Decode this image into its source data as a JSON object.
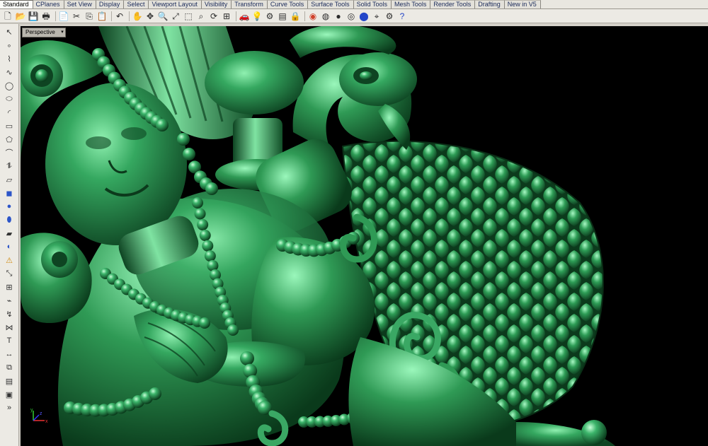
{
  "tabs": [
    "Standard",
    "CPlanes",
    "Set View",
    "Display",
    "Select",
    "Viewport Layout",
    "Visibility",
    "Transform",
    "Curve Tools",
    "Surface Tools",
    "Solid Tools",
    "Mesh Tools",
    "Render Tools",
    "Drafting",
    "New in V5"
  ],
  "active_tab": "Standard",
  "toolbar_icons": [
    "new-icon",
    "open-icon",
    "save-icon",
    "print-icon",
    "import-icon",
    "cut-icon",
    "copy-icon",
    "paste-icon",
    "undo-icon",
    "pan-icon",
    "move-view-icon",
    "zoom-icon",
    "zoom-extents-icon",
    "zoom-window-icon",
    "zoom-selected-icon",
    "rotate-view-icon",
    "four-viewports-icon",
    "car-icon",
    "bulb-icon",
    "tools-icon",
    "layer-icon",
    "lock-icon",
    "render-icon",
    "color-wheel-icon",
    "sphere-icon",
    "mesh-sphere-icon",
    "blue-sphere-icon",
    "snap-icon",
    "settings-icon",
    "help-icon"
  ],
  "sidebar_icons": [
    "select-arrow-icon",
    "point-icon",
    "polyline-icon",
    "curve-icon",
    "circle-icon",
    "ellipse-icon",
    "arc-icon",
    "rectangle-icon",
    "polygon-icon",
    "fillet-icon",
    "offset-icon",
    "surface-icon",
    "box-icon",
    "sphere-icon",
    "cylinder-icon",
    "plane-surface-icon",
    "boolean-icon",
    "analyze-icon",
    "transform-icon",
    "array-icon",
    "blend-icon",
    "sweep-icon",
    "loft-icon",
    "text-icon",
    "dimension-icon",
    "group-icon",
    "layers-icon",
    "block-icon",
    "more-icon"
  ],
  "viewport": {
    "label": "Perspective",
    "dropdown_glyph": "▾",
    "axis_x": "x",
    "axis_y": "y",
    "axis_z": "z",
    "model_color": "#2f9a55",
    "highlight_color": "#7fe0a0",
    "shadow_color": "#0c3a1c",
    "background": "#000000"
  }
}
